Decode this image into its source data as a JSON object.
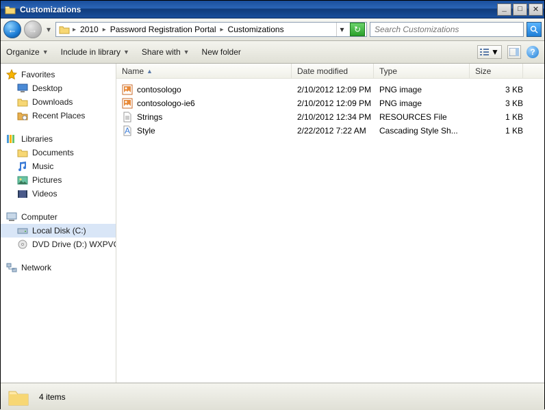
{
  "window": {
    "title": "Customizations"
  },
  "breadcrumb": [
    "2010",
    "Password Registration Portal",
    "Customizations"
  ],
  "search": {
    "placeholder": "Search Customizations"
  },
  "toolbar": {
    "organize": "Organize",
    "include": "Include in library",
    "share": "Share with",
    "newfolder": "New folder"
  },
  "sidebar": {
    "favorites": {
      "label": "Favorites",
      "items": [
        "Desktop",
        "Downloads",
        "Recent Places"
      ]
    },
    "libraries": {
      "label": "Libraries",
      "items": [
        "Documents",
        "Music",
        "Pictures",
        "Videos"
      ]
    },
    "computer": {
      "label": "Computer",
      "items": [
        "Local Disk (C:)",
        "DVD Drive (D:) WXPVO"
      ]
    },
    "network": {
      "label": "Network"
    }
  },
  "columns": {
    "name": "Name",
    "date": "Date modified",
    "type": "Type",
    "size": "Size"
  },
  "files": [
    {
      "name": "contosologo",
      "date": "2/10/2012 12:09 PM",
      "type": "PNG image",
      "size": "3 KB",
      "icon": "png"
    },
    {
      "name": "contosologo-ie6",
      "date": "2/10/2012 12:09 PM",
      "type": "PNG image",
      "size": "3 KB",
      "icon": "png"
    },
    {
      "name": "Strings",
      "date": "2/10/2012 12:34 PM",
      "type": "RESOURCES File",
      "size": "1 KB",
      "icon": "file"
    },
    {
      "name": "Style",
      "date": "2/22/2012 7:22 AM",
      "type": "Cascading Style Sh...",
      "size": "1 KB",
      "icon": "css"
    }
  ],
  "status": {
    "count": "4 items"
  }
}
